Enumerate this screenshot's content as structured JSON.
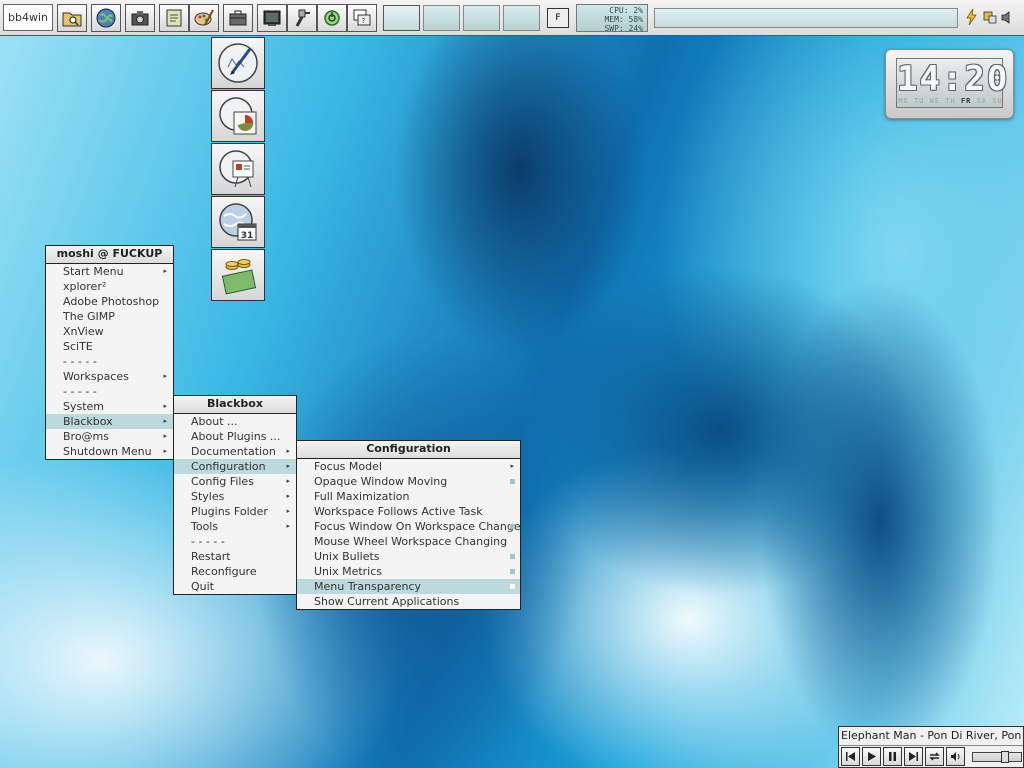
{
  "toolbar": {
    "label": "bb4win",
    "launch_buttons": [
      {
        "icon": "folder-search-icon"
      },
      {
        "icon": "globe-icon"
      },
      {
        "icon": "camera-icon"
      },
      {
        "icon": "notepad-icon"
      },
      {
        "icon": "paint-palette-icon"
      },
      {
        "icon": "briefcase-icon"
      },
      {
        "icon": "terminal-icon"
      },
      {
        "icon": "tools-icon"
      },
      {
        "icon": "power-icon"
      },
      {
        "icon": "window-icon"
      }
    ],
    "workspaces": [
      "",
      "",
      "",
      ""
    ],
    "active_workspace": 1,
    "focus_toggle": "F",
    "sysmon": {
      "cpu": "CPU: 2%",
      "mem": "MEM: 58%",
      "swp": "SWP: 24%"
    }
  },
  "launcher": {
    "items": [
      {
        "icon": "writer-document-icon"
      },
      {
        "icon": "pie-chart-presentation-icon"
      },
      {
        "icon": "slideshow-easel-icon"
      },
      {
        "icon": "globe-calendar-icon"
      },
      {
        "icon": "money-coins-icon"
      }
    ],
    "calendar_day": "31"
  },
  "clock": {
    "time": "14:20",
    "days": [
      "MO",
      "TU",
      "WE",
      "TH",
      "FR",
      "SA",
      "SU"
    ],
    "today_index": 4
  },
  "main_menu": {
    "title": "moshi @ FUCKUP",
    "items": [
      {
        "label": "Start Menu",
        "submenu": true
      },
      {
        "label": "xplorer²",
        "submenu": false
      },
      {
        "label": "Adobe Photoshop",
        "submenu": false
      },
      {
        "label": "The GIMP",
        "submenu": false
      },
      {
        "label": "XnView",
        "submenu": false
      },
      {
        "label": "SciTE",
        "submenu": false
      },
      {
        "label": "- - - - -",
        "submenu": false
      },
      {
        "label": "Workspaces",
        "submenu": true
      },
      {
        "label": "- - - - -",
        "submenu": false
      },
      {
        "label": "System",
        "submenu": true
      },
      {
        "label": "Blackbox",
        "submenu": true,
        "selected": true
      },
      {
        "label": "Bro@ms",
        "submenu": true
      },
      {
        "label": "Shutdown Menu",
        "submenu": true
      }
    ]
  },
  "blackbox_menu": {
    "title": "Blackbox",
    "items": [
      {
        "label": "About ...",
        "submenu": false
      },
      {
        "label": "About Plugins ...",
        "submenu": false
      },
      {
        "label": "Documentation",
        "submenu": true
      },
      {
        "label": "Configuration",
        "submenu": true,
        "selected": true
      },
      {
        "label": "Config Files",
        "submenu": true
      },
      {
        "label": "Styles",
        "submenu": true
      },
      {
        "label": "Plugins Folder",
        "submenu": true
      },
      {
        "label": "Tools",
        "submenu": true
      },
      {
        "label": "- - - - -",
        "submenu": false
      },
      {
        "label": "Restart",
        "submenu": false
      },
      {
        "label": "Reconfigure",
        "submenu": false
      },
      {
        "label": "Quit",
        "submenu": false
      }
    ]
  },
  "config_menu": {
    "title": "Configuration",
    "items": [
      {
        "label": "Focus Model",
        "submenu": true,
        "checked": false
      },
      {
        "label": "Opaque Window Moving",
        "checked": true
      },
      {
        "label": "Full Maximization",
        "checked": false
      },
      {
        "label": "Workspace Follows Active Task",
        "checked": false
      },
      {
        "label": "Focus Window On Workspace Change",
        "checked": true
      },
      {
        "label": "Mouse Wheel Workspace Changing",
        "checked": false
      },
      {
        "label": "Unix Bullets",
        "checked": true
      },
      {
        "label": "Unix Metrics",
        "checked": true
      },
      {
        "label": "Menu Transparency",
        "checked": true,
        "selected": true
      },
      {
        "label": "Show Current Applications",
        "checked": false
      }
    ]
  },
  "player": {
    "now_playing": "Elephant Man - Pon Di River, Pon Di Bank",
    "volume": 0.7
  },
  "colors": {
    "menu_bg": "#f4f4f4",
    "menu_selected": "#bcd9dd",
    "bullet": "#9cc7d0"
  }
}
